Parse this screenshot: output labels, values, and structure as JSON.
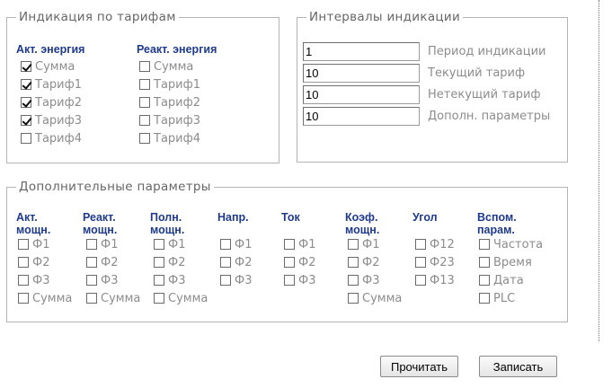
{
  "tariffs": {
    "legend": "Индикация по тарифам",
    "active": {
      "header": "Акт. энергия",
      "items": [
        {
          "label": "Сумма",
          "checked": true
        },
        {
          "label": "Тариф1",
          "checked": true
        },
        {
          "label": "Тариф2",
          "checked": true
        },
        {
          "label": "Тариф3",
          "checked": true
        },
        {
          "label": "Тариф4",
          "checked": false
        }
      ]
    },
    "reactive": {
      "header": "Реакт. энергия",
      "items": [
        {
          "label": "Сумма",
          "checked": false
        },
        {
          "label": "Тариф1",
          "checked": false
        },
        {
          "label": "Тариф2",
          "checked": false
        },
        {
          "label": "Тариф3",
          "checked": false
        },
        {
          "label": "Тариф4",
          "checked": false
        }
      ]
    }
  },
  "intervals": {
    "legend": "Интервалы индикации",
    "rows": [
      {
        "value": "1",
        "label": "Период индикации"
      },
      {
        "value": "10",
        "label": "Текущий тариф"
      },
      {
        "value": "10",
        "label": "Нетекущий тариф"
      },
      {
        "value": "10",
        "label": "Дополн. параметры"
      }
    ]
  },
  "extra": {
    "legend": "Дополнительные параметры",
    "columns": [
      {
        "header": [
          "Акт.",
          "мощн."
        ],
        "items": [
          "Ф1",
          "Ф2",
          "Ф3",
          "Сумма"
        ]
      },
      {
        "header": [
          "Реакт.",
          "мощн."
        ],
        "items": [
          "Ф1",
          "Ф2",
          "Ф3",
          "Сумма"
        ]
      },
      {
        "header": [
          "Полн.",
          "мощн."
        ],
        "items": [
          "Ф1",
          "Ф2",
          "Ф3",
          "Сумма"
        ]
      },
      {
        "header": [
          "Напр."
        ],
        "items": [
          "Ф1",
          "Ф2",
          "Ф3"
        ]
      },
      {
        "header": [
          "Ток"
        ],
        "items": [
          "Ф1",
          "Ф2",
          "Ф3"
        ]
      },
      {
        "header": [
          "Коэф.",
          "мощн."
        ],
        "items": [
          "Ф1",
          "Ф2",
          "Ф3",
          "Сумма"
        ]
      },
      {
        "header": [
          "Угол"
        ],
        "items": [
          "Ф12",
          "Ф23",
          "Ф13"
        ]
      },
      {
        "header": [
          "Вспом.",
          "парам."
        ],
        "items": [
          "Частота",
          "Время",
          "Дата",
          "PLC"
        ]
      }
    ]
  },
  "buttons": {
    "read": "Прочитать",
    "write": "Записать"
  }
}
